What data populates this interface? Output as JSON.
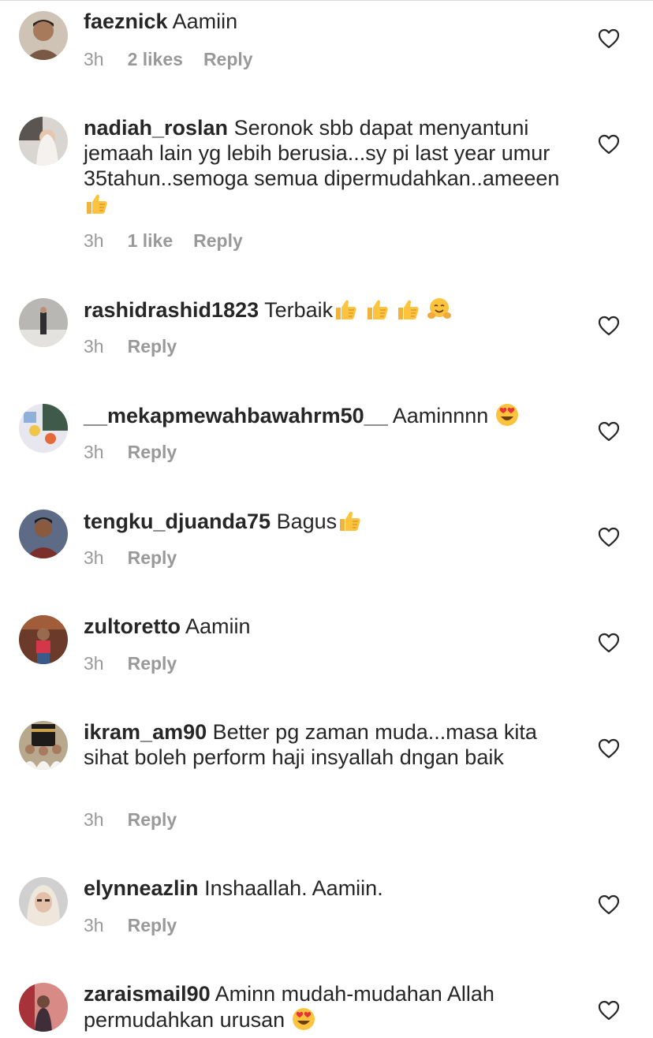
{
  "comments": [
    {
      "user": "faeznick",
      "text": "Aamiin",
      "time": "3h",
      "likes": "2 likes",
      "reply": "Reply"
    },
    {
      "user": "nadiah_roslan",
      "text": "Seronok sbb dapat menyantuni jemaah lain yg lebih berusia...sy pi last year umur 35tahun..semoga semua dipermudahkan..ameeen",
      "time": "3h",
      "likes": "1 like",
      "reply": "Reply"
    },
    {
      "user": "rashidrashid1823",
      "text": "Terbaik",
      "time": "3h",
      "reply": "Reply"
    },
    {
      "user": "__mekapmewahbawahrm50__",
      "text": "Aaminnnn",
      "time": "3h",
      "reply": "Reply"
    },
    {
      "user": "tengku_djuanda75",
      "text": "Bagus",
      "time": "3h",
      "reply": "Reply"
    },
    {
      "user": "zultoretto",
      "text": "Aamiin",
      "time": "3h",
      "reply": "Reply"
    },
    {
      "user": "ikram_am90",
      "text": "Better pg zaman muda...masa kita sihat boleh perform haji insyallah dngan baik",
      "time": "3h",
      "reply": "Reply"
    },
    {
      "user": "elynneazlin",
      "text": "Inshaallah. Aamiin.",
      "time": "3h",
      "reply": "Reply"
    },
    {
      "user": "zaraismail90",
      "text": "Aminn mudah-mudahan Allah permudahkan urusan",
      "time": "",
      "reply": ""
    }
  ],
  "icons": {
    "like": "heart-outline-icon",
    "thumbs": "thumbs-up-emoji",
    "hug": "hugging-face-emoji",
    "hearteyes": "heart-eyes-emoji"
  },
  "colors": {
    "text": "#262626",
    "meta": "#999999",
    "heart": "#262626",
    "divider": "#dbdbdb"
  }
}
